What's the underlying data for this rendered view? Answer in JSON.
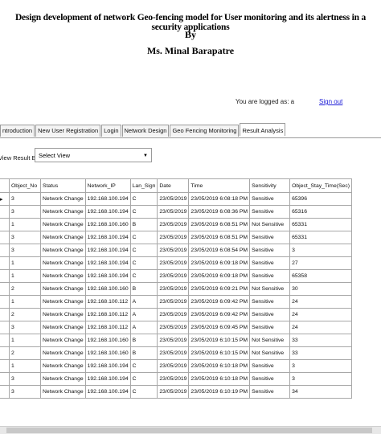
{
  "header": {
    "line1": "Design  development of network Geo-fencing model for User monitoring and its alertness in a security applications",
    "line2": "By",
    "line3": "Ms. Minal Barapatre"
  },
  "session": {
    "logged_label": "You are logged as: a",
    "signout": "Sign out"
  },
  "tabs": [
    {
      "label": "ntroduction"
    },
    {
      "label": "New User Registration"
    },
    {
      "label": "Login"
    },
    {
      "label": "Network Design"
    },
    {
      "label": "Geo Fencing Monitoring"
    },
    {
      "label": "Result Analysis"
    }
  ],
  "filter": {
    "label": "View Result By",
    "selected": "Select View"
  },
  "table": {
    "headers": [
      "Object_No",
      "Status",
      "Network_IP",
      "Lan_Sign",
      "Date",
      "Time",
      "Sensitivity",
      "Object_Stay_Time(Sec)"
    ],
    "rows": [
      [
        "3",
        "Network Change",
        "192.168.100.194",
        "C",
        "23/05/2019",
        "23/05/2019 6:08:18 PM",
        "Sensitive",
        "65396"
      ],
      [
        "3",
        "Network Change",
        "192.168.100.194",
        "C",
        "23/05/2019",
        "23/05/2019 6:08:36 PM",
        "Sensitive",
        "65316"
      ],
      [
        "1",
        "Network Change",
        "192.168.100.160",
        "B",
        "23/05/2019",
        "23/05/2019 6:08:51 PM",
        "Not Sensitive",
        "65331"
      ],
      [
        "3",
        "Network Change",
        "192.168.100.194",
        "C",
        "23/05/2019",
        "23/05/2019 6:08:51 PM",
        "Sensitive",
        "65331"
      ],
      [
        "3",
        "Network Change",
        "192.168.100.194",
        "C",
        "23/05/2019",
        "23/05/2019 6:08:54 PM",
        "Sensitive",
        "3"
      ],
      [
        "1",
        "Network Change",
        "192.168.100.194",
        "C",
        "23/05/2019",
        "23/05/2019 6:09:18 PM",
        "Sensitive",
        "27"
      ],
      [
        "1",
        "Network Change",
        "192.168.100.194",
        "C",
        "23/05/2019",
        "23/05/2019 6:09:18 PM",
        "Sensitive",
        "65358"
      ],
      [
        "2",
        "Network Change",
        "192.168.100.160",
        "B",
        "23/05/2019",
        "23/05/2019 6:09:21 PM",
        "Not Sensitive",
        "30"
      ],
      [
        "1",
        "Network Change",
        "192.168.100.112",
        "A",
        "23/05/2019",
        "23/05/2019 6:09:42 PM",
        "Sensitive",
        "24"
      ],
      [
        "2",
        "Network Change",
        "192.168.100.112",
        "A",
        "23/05/2019",
        "23/05/2019 6:09:42 PM",
        "Sensitive",
        "24"
      ],
      [
        "3",
        "Network Change",
        "192.168.100.112",
        "A",
        "23/05/2019",
        "23/05/2019 6:09:45 PM",
        "Sensitive",
        "24"
      ],
      [
        "1",
        "Network Change",
        "192.168.100.160",
        "B",
        "23/05/2019",
        "23/05/2019 6:10:15 PM",
        "Not Sensitive",
        "33"
      ],
      [
        "2",
        "Network Change",
        "192.168.100.160",
        "B",
        "23/05/2019",
        "23/05/2019 6:10:15 PM",
        "Not Sensitive",
        "33"
      ],
      [
        "1",
        "Network Change",
        "192.168.100.194",
        "C",
        "23/05/2019",
        "23/05/2019 6:10:18 PM",
        "Sensitive",
        "3"
      ],
      [
        "3",
        "Network Change",
        "192.168.100.194",
        "C",
        "23/05/2019",
        "23/05/2019 6:10:18 PM",
        "Sensitive",
        "3"
      ],
      [
        "3",
        "Network Change",
        "192.168.100.194",
        "C",
        "23/05/2019",
        "23/05/2019 6:10:19 PM",
        "Sensitive",
        "34"
      ]
    ]
  }
}
